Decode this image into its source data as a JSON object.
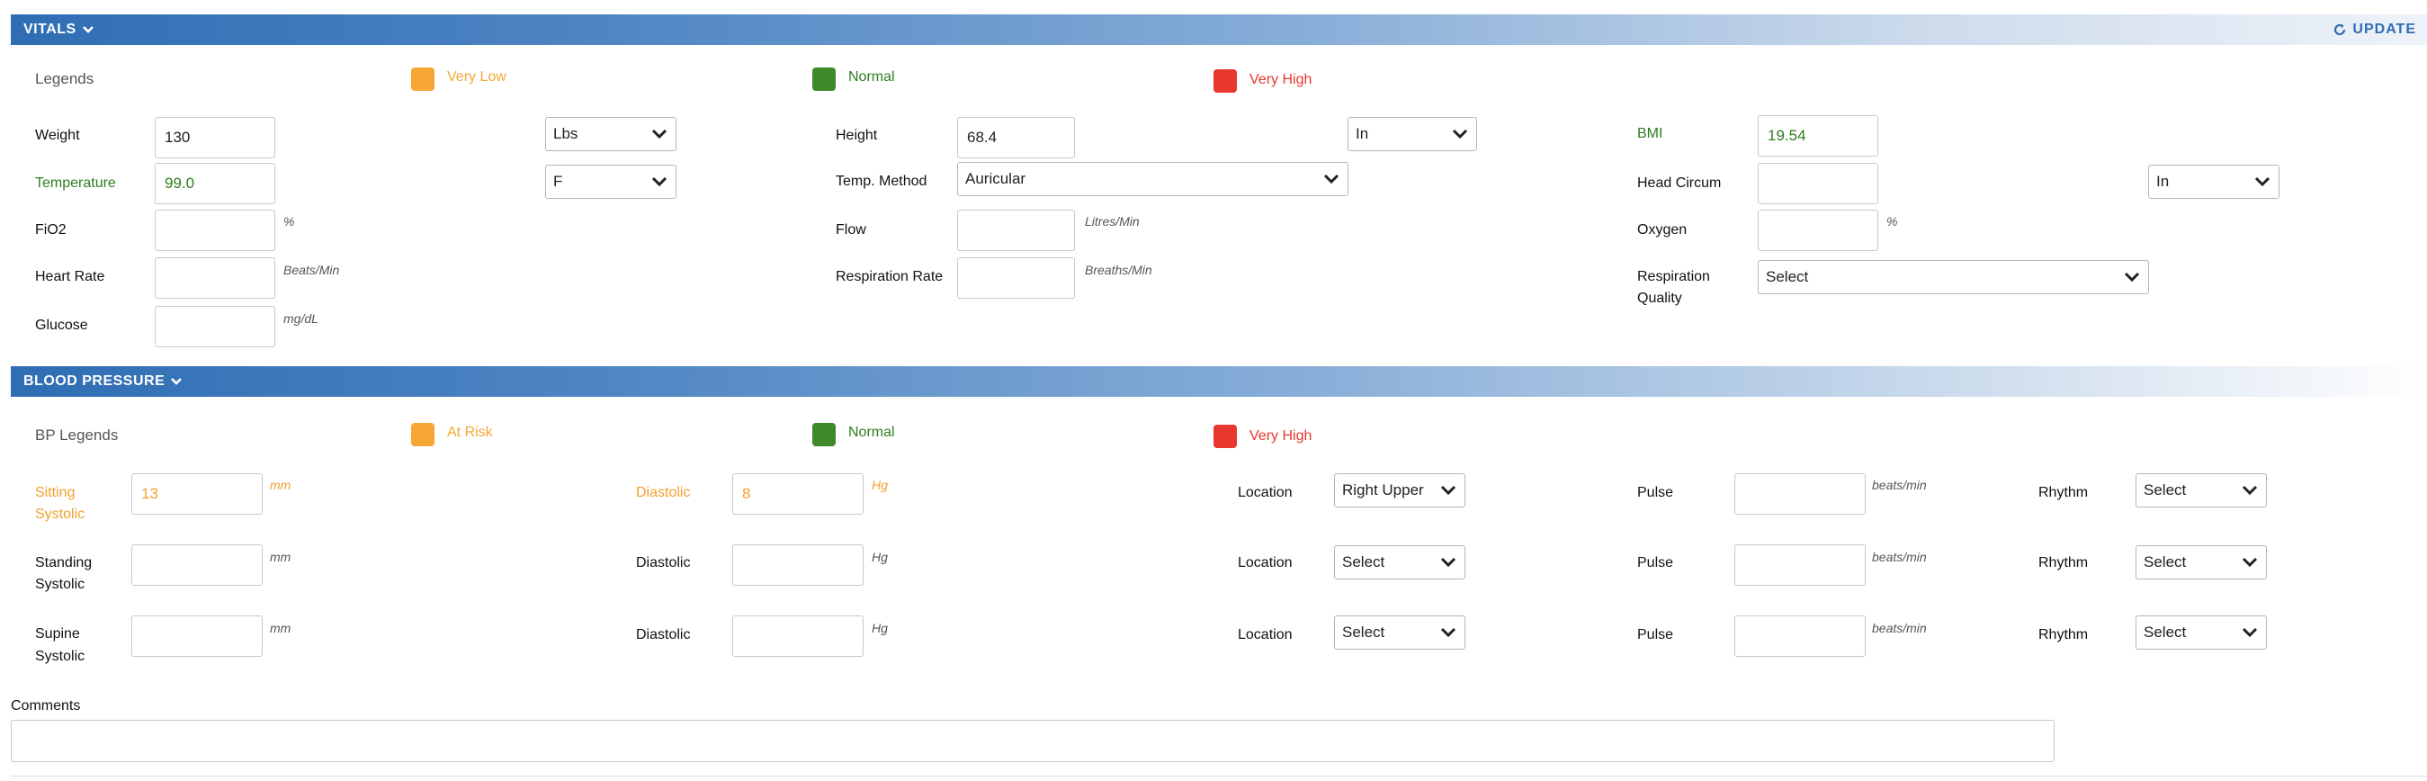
{
  "vitals": {
    "title": "VITALS",
    "update_label": "UPDATE",
    "legends_label": "Legends",
    "legend_items": [
      {
        "label": "Very Low",
        "color": "#f5a634"
      },
      {
        "label": "Normal",
        "color": "#3e8a2a"
      },
      {
        "label": "Very High",
        "color": "#e8372e"
      }
    ],
    "weight": {
      "label": "Weight",
      "value": "130",
      "unit": "Lbs"
    },
    "height": {
      "label": "Height",
      "value": "68.4",
      "unit": "In"
    },
    "bmi": {
      "label": "BMI",
      "value": "19.54"
    },
    "temperature": {
      "label": "Temperature",
      "value": "99.0",
      "unit": "F"
    },
    "temp_method": {
      "label": "Temp. Method",
      "value": "Auricular"
    },
    "head_circum": {
      "label": "Head Circum",
      "value": "",
      "unit": "In"
    },
    "fio2": {
      "label": "FiO2",
      "value": "",
      "unit": "%"
    },
    "flow": {
      "label": "Flow",
      "value": "",
      "unit": "Litres/Min"
    },
    "oxygen": {
      "label": "Oxygen",
      "value": "",
      "unit": "%"
    },
    "heart_rate": {
      "label": "Heart Rate",
      "value": "",
      "unit": "Beats/Min"
    },
    "respiration_rate": {
      "label": "Respiration Rate",
      "value": "",
      "unit": "Breaths/Min"
    },
    "respiration_quality": {
      "label_line1": "Respiration",
      "label_line2": "Quality",
      "value": "Select"
    },
    "glucose": {
      "label": "Glucose",
      "value": "",
      "unit": "mg/dL"
    }
  },
  "bp": {
    "title": "BLOOD PRESSURE",
    "legends_label": "BP Legends",
    "legend_items": [
      {
        "label": "At Risk",
        "color": "#f5a634"
      },
      {
        "label": "Normal",
        "color": "#3e8a2a"
      },
      {
        "label": "Very High",
        "color": "#e8372e"
      }
    ],
    "rows": [
      {
        "sys_label_1": "Sitting",
        "sys_label_2": "Systolic",
        "sys_value": "13",
        "sys_unit": "mm",
        "dia_label": "Diastolic",
        "dia_value": "8",
        "dia_unit": "Hg",
        "location_label": "Location",
        "location_value": "Right Upper",
        "pulse_label": "Pulse",
        "pulse_value": "",
        "pulse_unit": "beats/min",
        "rhythm_label": "Rhythm",
        "rhythm_value": "Select"
      },
      {
        "sys_label_1": "Standing",
        "sys_label_2": "Systolic",
        "sys_value": "",
        "sys_unit": "mm",
        "dia_label": "Diastolic",
        "dia_value": "",
        "dia_unit": "Hg",
        "location_label": "Location",
        "location_value": "Select",
        "pulse_label": "Pulse",
        "pulse_value": "",
        "pulse_unit": "beats/min",
        "rhythm_label": "Rhythm",
        "rhythm_value": "Select"
      },
      {
        "sys_label_1": "Supine",
        "sys_label_2": "Systolic",
        "sys_value": "",
        "sys_unit": "mm",
        "dia_label": "Diastolic",
        "dia_value": "",
        "dia_unit": "Hg",
        "location_label": "Location",
        "location_value": "Select",
        "pulse_label": "Pulse",
        "pulse_value": "",
        "pulse_unit": "beats/min",
        "rhythm_label": "Rhythm",
        "rhythm_value": "Select"
      }
    ]
  },
  "comments": {
    "label": "Comments",
    "value": ""
  },
  "icons": {
    "collapse": "chevron-down-icon",
    "update": "refresh-icon",
    "dropdown": "chevron-down-icon"
  }
}
